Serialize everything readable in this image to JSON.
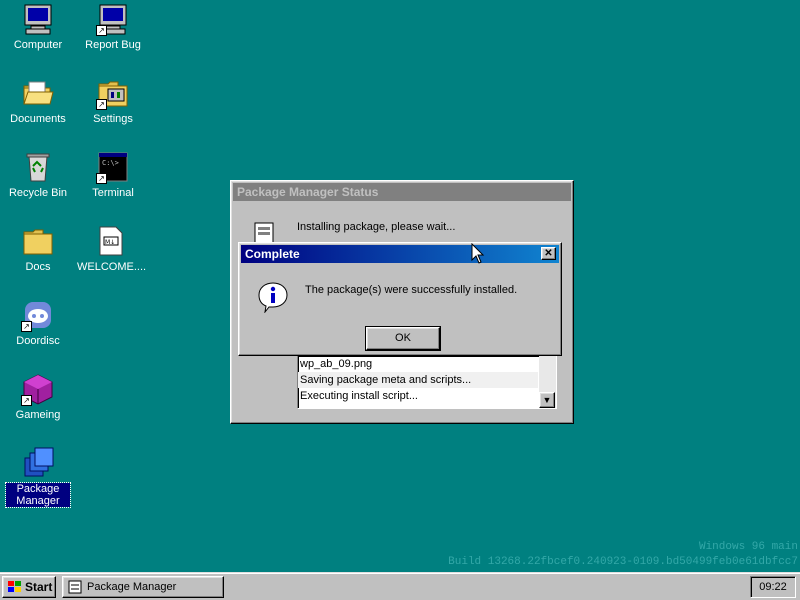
{
  "desktop": {
    "icons": [
      {
        "label": "Computer"
      },
      {
        "label": "Report Bug"
      },
      {
        "label": "Documents"
      },
      {
        "label": "Settings"
      },
      {
        "label": "Recycle Bin"
      },
      {
        "label": "Terminal"
      },
      {
        "label": "Docs"
      },
      {
        "label": "WELCOME...."
      },
      {
        "label": "Doordisc"
      },
      {
        "label": "Gameing"
      },
      {
        "label": "Package Manager"
      }
    ],
    "watermark": {
      "line1": "Windows 96 main",
      "line2": "Build 13268.22fbcef0.240923-0109.bd50499feb0e61dbfcc7"
    }
  },
  "package_window": {
    "title": "Package Manager Status",
    "status": "Installing package, please wait...",
    "log": [
      "wp_ab_09.png",
      "Saving package meta and scripts...",
      "Executing install script..."
    ]
  },
  "dialog": {
    "title": "Complete",
    "close_label": "✕",
    "message": "The package(s) were successfully installed.",
    "ok_label": "OK"
  },
  "taskbar": {
    "start_label": "Start",
    "task_label": "Package Manager",
    "clock": "09:22"
  },
  "colors": {
    "desktop": "#008080",
    "title_active": "#000080",
    "title_inactive": "#808080",
    "face": "#c0c0c0"
  }
}
